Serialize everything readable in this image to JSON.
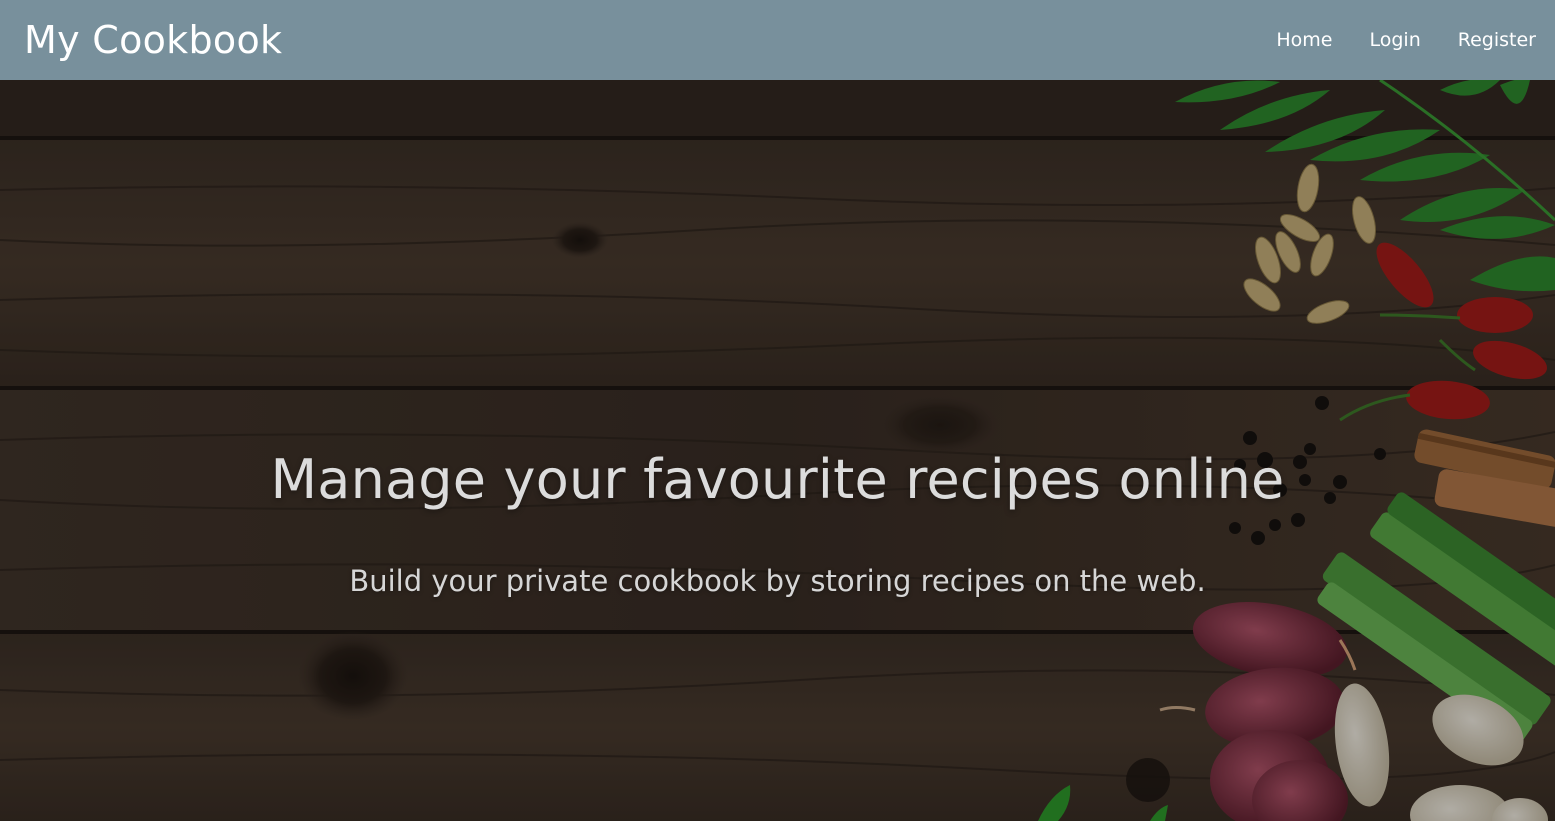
{
  "navbar": {
    "brand": "My Cookbook",
    "links": [
      {
        "label": "Home"
      },
      {
        "label": "Login"
      },
      {
        "label": "Register"
      }
    ]
  },
  "hero": {
    "title": "Manage your favourite recipes online",
    "subtitle": "Build your private cookbook by storing recipes on the web."
  },
  "colors": {
    "navbar_bg": "#78909c",
    "nav_text": "#ffffff",
    "hero_text": "#dcdcdc",
    "wood": "#3a2e26"
  }
}
